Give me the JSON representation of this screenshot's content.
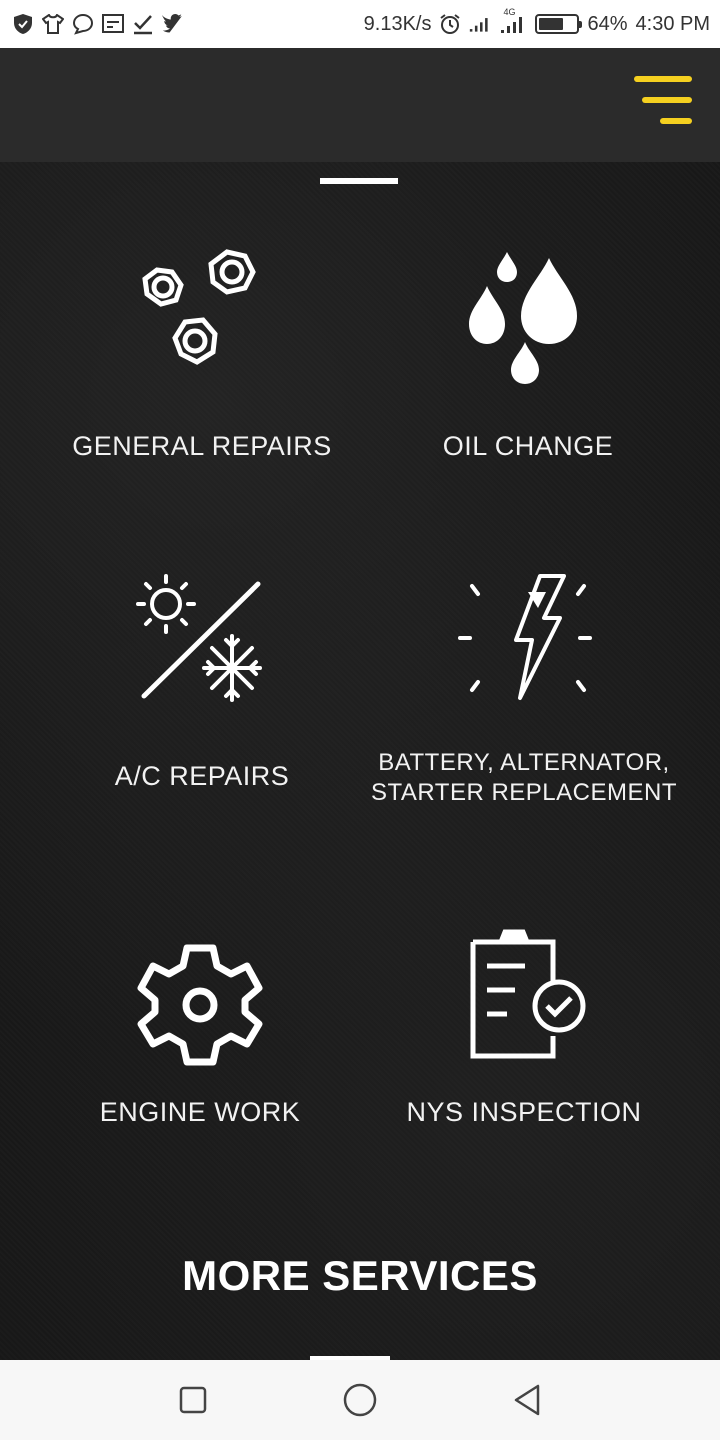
{
  "status_bar": {
    "left_icons": [
      "shield-icon",
      "shirt-icon",
      "chat-icon",
      "cast-icon",
      "checkmark-icon",
      "twitter-icon"
    ],
    "speed": "9.13K/s",
    "network_label": "4G",
    "battery_percent": "64%",
    "battery_level": 0.64,
    "time": "4:30 PM"
  },
  "header": {
    "menu_icon": "hamburger-menu-icon",
    "accent_color": "#f5d020"
  },
  "services": [
    {
      "label": "GENERAL REPAIRS",
      "icon": "hex-nuts-icon"
    },
    {
      "label": "OIL CHANGE",
      "icon": "oil-drops-icon"
    },
    {
      "label": "A/C REPAIRS",
      "icon": "sun-snowflake-icon"
    },
    {
      "label": "BATTERY, ALTERNATOR,",
      "label_line2": "STARTER REPLACEMENT",
      "icon": "lightning-bolt-icon"
    },
    {
      "label": "ENGINE WORK",
      "icon": "gear-icon"
    },
    {
      "label": "NYS INSPECTION",
      "icon": "clipboard-check-icon"
    }
  ],
  "more_services_label": "MORE SERVICES",
  "nav_bar": {
    "icons": [
      "recent-apps-icon",
      "home-icon",
      "back-icon"
    ]
  }
}
